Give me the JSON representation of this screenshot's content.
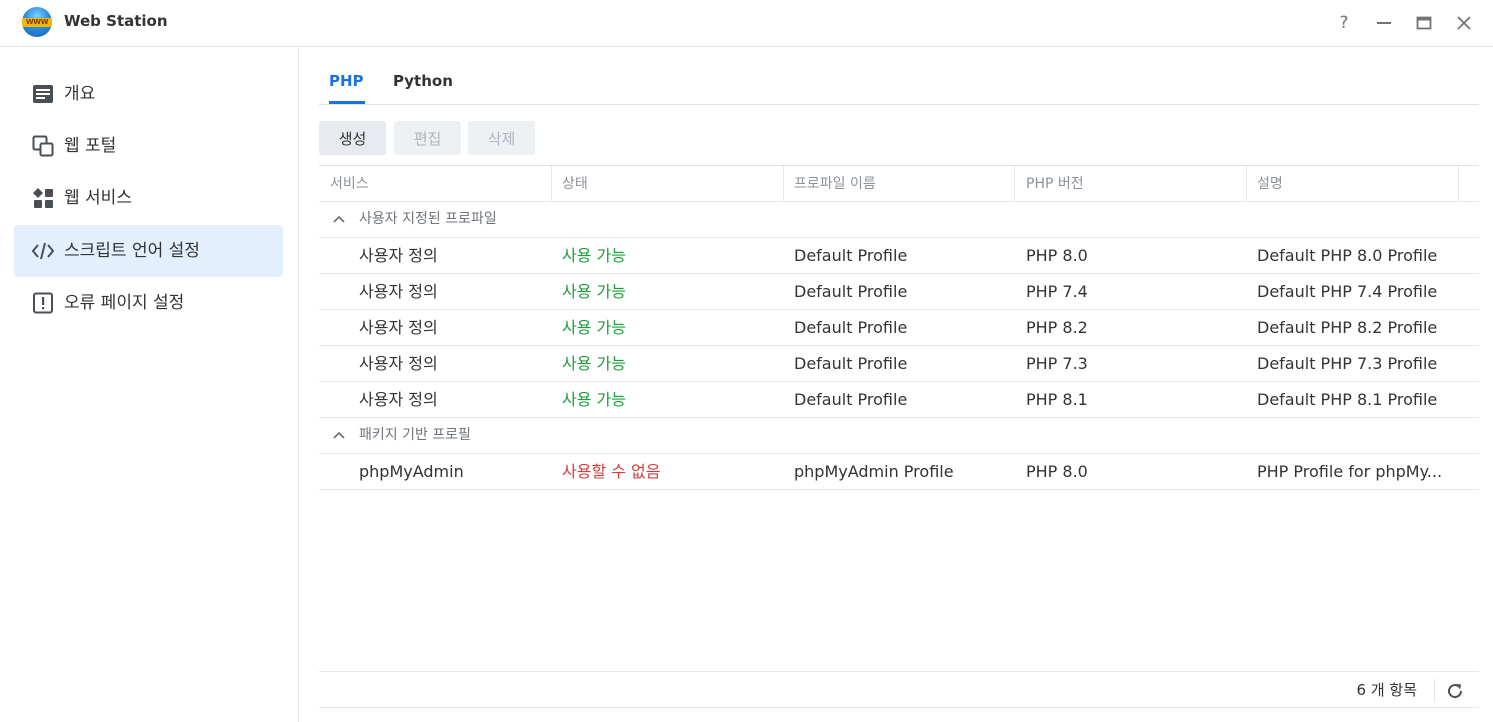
{
  "window": {
    "title": "Web Station",
    "logo_text": "WWW",
    "controls": {
      "help": "?",
      "minimize": "—",
      "maximize": "□",
      "close": "✕"
    }
  },
  "sidebar": {
    "items": [
      {
        "label": "개요",
        "icon": "overview-icon"
      },
      {
        "label": "웹 포털",
        "icon": "web-portal-icon"
      },
      {
        "label": "웹 서비스",
        "icon": "web-service-icon"
      },
      {
        "label": "스크립트 언어 설정",
        "icon": "code-icon",
        "active": true
      },
      {
        "label": "오류 페이지 설정",
        "icon": "error-page-icon"
      }
    ]
  },
  "tabs": [
    {
      "label": "PHP",
      "active": true
    },
    {
      "label": "Python"
    }
  ],
  "toolbar": {
    "create": "생성",
    "edit": "편집",
    "delete": "삭제"
  },
  "table": {
    "columns": [
      "서비스",
      "상태",
      "프로파일 이름",
      "PHP 버전",
      "설명"
    ],
    "groups": [
      {
        "label": "사용자 지정된 프로파일",
        "rows": [
          {
            "service": "사용자 정의",
            "status": "사용 가능",
            "profile": "Default Profile",
            "version": "PHP 8.0",
            "description": "Default PHP 8.0 Profile"
          },
          {
            "service": "사용자 정의",
            "status": "사용 가능",
            "profile": "Default Profile",
            "version": "PHP 7.4",
            "description": "Default PHP 7.4 Profile"
          },
          {
            "service": "사용자 정의",
            "status": "사용 가능",
            "profile": "Default Profile",
            "version": "PHP 8.2",
            "description": "Default PHP 8.2 Profile"
          },
          {
            "service": "사용자 정의",
            "status": "사용 가능",
            "profile": "Default Profile",
            "version": "PHP 7.3",
            "description": "Default PHP 7.3 Profile"
          },
          {
            "service": "사용자 정의",
            "status": "사용 가능",
            "profile": "Default Profile",
            "version": "PHP 8.1",
            "description": "Default PHP 8.1 Profile"
          }
        ]
      },
      {
        "label": "패키지 기반 프로필",
        "rows": [
          {
            "service": "phpMyAdmin",
            "status": "사용할 수 없음",
            "profile": "phpMyAdmin Profile",
            "version": "PHP 8.0",
            "description": "PHP Profile for phpMy..."
          }
        ]
      }
    ]
  },
  "footer": {
    "count": "6 개 항목"
  },
  "colors": {
    "accent": "#1a73d8",
    "ok": "#1e9e3a",
    "error": "#d83b3b",
    "active_bg": "#e3effc"
  }
}
